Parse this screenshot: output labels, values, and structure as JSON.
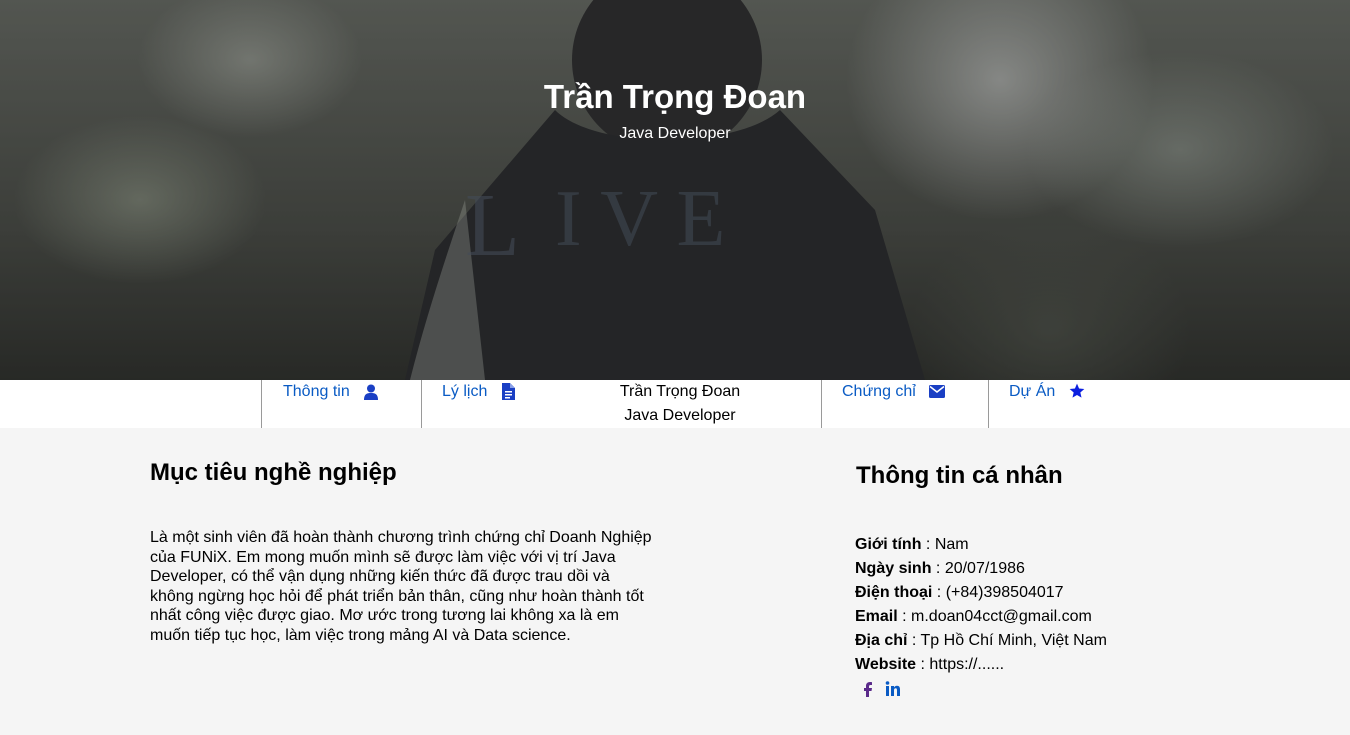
{
  "hero": {
    "name": "Trần Trọng Đoan",
    "role": "Java Developer"
  },
  "nav": {
    "items": [
      {
        "label": "Thông tin",
        "icon": "user-icon"
      },
      {
        "label": "Lý lịch",
        "icon": "document-icon"
      },
      {
        "label": "Chứng chỉ",
        "icon": "envelope-icon"
      },
      {
        "label": "Dự Án",
        "icon": "star-icon"
      }
    ],
    "center_name": "Trần Trọng Đoan",
    "center_role": "Java Developer"
  },
  "objective": {
    "title": "Mục tiêu nghề nghiệp",
    "text": "Là một sinh viên đã hoàn thành chương trình chứng chỉ Doanh Nghiệp của FUNiX. Em mong muốn mình sẽ được làm việc với vị trí Java Developer, có thể vận dụng những kiến thức đã được trau dồi và không ngừng học hỏi để phát triển bản thân, cũng như hoàn thành tốt nhất công việc được giao. Mơ ước trong tương lai không xa là em muốn tiếp tục học, làm việc trong mảng AI và Data science."
  },
  "personal": {
    "title": "Thông tin cá nhân",
    "rows": [
      {
        "key": "Giới tính",
        "sep": " : ",
        "value": "Nam"
      },
      {
        "key": "Ngày sinh",
        "sep": " : ",
        "value": "20/07/1986"
      },
      {
        "key": "Điện thoại",
        "sep": " : ",
        "value": "(+84)398504017"
      },
      {
        "key": "Email",
        "sep": " : ",
        "value": "m.doan04cct@gmail.com"
      },
      {
        "key": "Địa chỉ",
        "sep": " : ",
        "value": "Tp Hồ Chí Minh, Việt Nam"
      },
      {
        "key": "Website",
        "sep": " : ",
        "value": "https://......"
      }
    ],
    "social": [
      {
        "icon": "facebook-icon",
        "color": "#5a2a8a"
      },
      {
        "icon": "linkedin-icon",
        "color": "#0a5bc4"
      }
    ]
  },
  "colors": {
    "link": "#0a5bc4",
    "nav_icon": "#1a3fc4",
    "star": "#0b1fe0",
    "page_bg": "#f5f5f5"
  }
}
